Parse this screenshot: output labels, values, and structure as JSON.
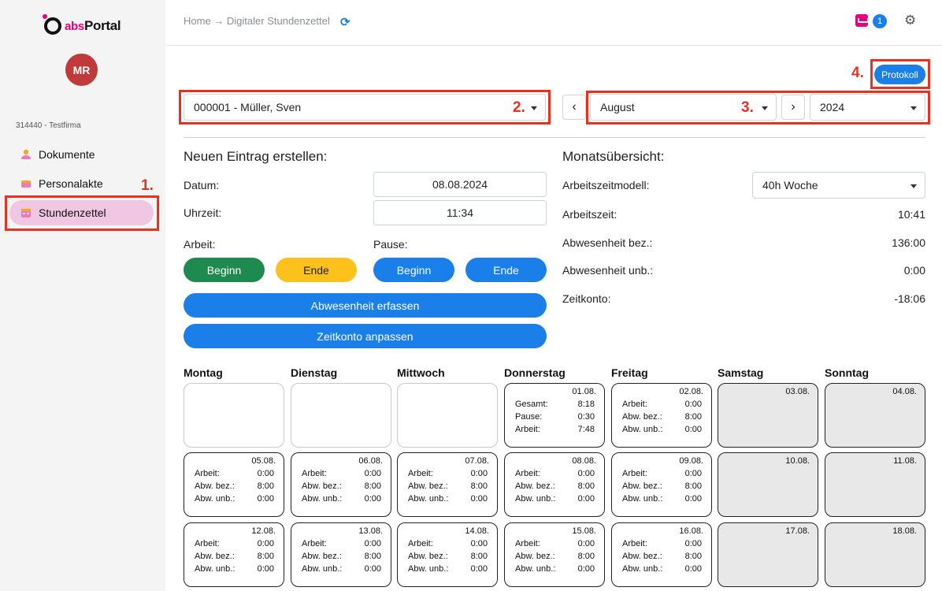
{
  "sidebar": {
    "logo": {
      "abs": "abs",
      "portal": "Portal"
    },
    "avatar": "MR",
    "company": "314440 - Testfirma",
    "items": [
      {
        "label": "Dokumente",
        "icon": "person-icon"
      },
      {
        "label": "Personalakte",
        "icon": "folder-icon"
      },
      {
        "label": "Stundenzettel",
        "icon": "calendar-icon",
        "active": true
      }
    ]
  },
  "annotations": {
    "one": "1.",
    "two": "2.",
    "three": "3.",
    "four": "4."
  },
  "header": {
    "breadcrumb": "Home → Digitaler Stundenzettel",
    "badge_count": "1"
  },
  "controls": {
    "protocol_label": "Protokoll",
    "employee": "000001 - Müller, Sven",
    "month": "August",
    "year": "2024",
    "prev": "‹",
    "next": "›"
  },
  "entry": {
    "title": "Neuen Eintrag erstellen:",
    "date_label": "Datum:",
    "date_value": "08.08.2024",
    "time_label": "Uhrzeit:",
    "time_value": "11:34",
    "work_label": "Arbeit:",
    "pause_label": "Pause:",
    "work_begin": "Beginn",
    "work_end": "Ende",
    "pause_begin": "Beginn",
    "pause_end": "Ende",
    "absence_btn": "Abwesenheit erfassen",
    "account_btn": "Zeitkonto anpassen"
  },
  "summary": {
    "title": "Monatsübersicht:",
    "model_label": "Arbeitszeitmodell:",
    "model_value": "40h Woche",
    "worktime_label": "Arbeitszeit:",
    "worktime_value": "10:41",
    "abs_paid_label": "Abwesenheit bez.:",
    "abs_paid_value": "136:00",
    "abs_unpaid_label": "Abwesenheit unb.:",
    "abs_unpaid_value": "0:00",
    "account_label": "Zeitkonto:",
    "account_value": "-18:06"
  },
  "calendar": {
    "weekdays": [
      "Montag",
      "Dienstag",
      "Mittwoch",
      "Donnerstag",
      "Freitag",
      "Samstag",
      "Sonntag"
    ],
    "weeks": [
      [
        {
          "empty": true
        },
        {
          "empty": true
        },
        {
          "empty": true
        },
        {
          "date": "01.08.",
          "rows": [
            [
              "Gesamt:",
              "8:18"
            ],
            [
              "Pause:",
              "0:30"
            ],
            [
              "Arbeit:",
              "7:48"
            ]
          ]
        },
        {
          "date": "02.08.",
          "rows": [
            [
              "Arbeit:",
              "0:00"
            ],
            [
              "Abw. bez.:",
              "8:00"
            ],
            [
              "Abw. unb.:",
              "0:00"
            ]
          ]
        },
        {
          "date": "03.08.",
          "weekend": true,
          "rows": []
        },
        {
          "date": "04.08.",
          "weekend": true,
          "rows": []
        }
      ],
      [
        {
          "date": "05.08.",
          "rows": [
            [
              "Arbeit:",
              "0:00"
            ],
            [
              "Abw. bez.:",
              "8:00"
            ],
            [
              "Abw. unb.:",
              "0:00"
            ]
          ]
        },
        {
          "date": "06.08.",
          "rows": [
            [
              "Arbeit:",
              "0:00"
            ],
            [
              "Abw. bez.:",
              "8:00"
            ],
            [
              "Abw. unb.:",
              "0:00"
            ]
          ]
        },
        {
          "date": "07.08.",
          "rows": [
            [
              "Arbeit:",
              "0:00"
            ],
            [
              "Abw. bez.:",
              "8:00"
            ],
            [
              "Abw. unb.:",
              "0:00"
            ]
          ]
        },
        {
          "date": "08.08.",
          "rows": [
            [
              "Arbeit:",
              "0:00"
            ],
            [
              "Abw. bez.:",
              "8:00"
            ],
            [
              "Abw. unb.:",
              "0:00"
            ]
          ]
        },
        {
          "date": "09.08.",
          "rows": [
            [
              "Arbeit:",
              "0:00"
            ],
            [
              "Abw. bez.:",
              "8:00"
            ],
            [
              "Abw. unb.:",
              "0:00"
            ]
          ]
        },
        {
          "date": "10.08.",
          "weekend": true,
          "rows": []
        },
        {
          "date": "11.08.",
          "weekend": true,
          "rows": []
        }
      ],
      [
        {
          "date": "12.08.",
          "rows": [
            [
              "Arbeit:",
              "0:00"
            ],
            [
              "Abw. bez.:",
              "8:00"
            ],
            [
              "Abw. unb.:",
              "0:00"
            ]
          ]
        },
        {
          "date": "13.08.",
          "rows": [
            [
              "Arbeit:",
              "0:00"
            ],
            [
              "Abw. bez.:",
              "8:00"
            ],
            [
              "Abw. unb.:",
              "0:00"
            ]
          ]
        },
        {
          "date": "14.08.",
          "rows": [
            [
              "Arbeit:",
              "0:00"
            ],
            [
              "Abw. bez.:",
              "8:00"
            ],
            [
              "Abw. unb.:",
              "0:00"
            ]
          ]
        },
        {
          "date": "15.08.",
          "rows": [
            [
              "Arbeit:",
              "0:00"
            ],
            [
              "Abw. bez.:",
              "8:00"
            ],
            [
              "Abw. unb.:",
              "0:00"
            ]
          ]
        },
        {
          "date": "16.08.",
          "rows": [
            [
              "Arbeit:",
              "0:00"
            ],
            [
              "Abw. bez.:",
              "8:00"
            ],
            [
              "Abw. unb.:",
              "0:00"
            ]
          ]
        },
        {
          "date": "17.08.",
          "weekend": true,
          "rows": []
        },
        {
          "date": "18.08.",
          "weekend": true,
          "rows": []
        }
      ]
    ]
  },
  "colors": {
    "primary": "#1a7fe8",
    "work_begin": "#1e8a4f",
    "work_end": "#fcc11a",
    "annotation": "#e8311f",
    "active_nav": "#f0c7e2",
    "brand_pink": "#e5007d"
  }
}
